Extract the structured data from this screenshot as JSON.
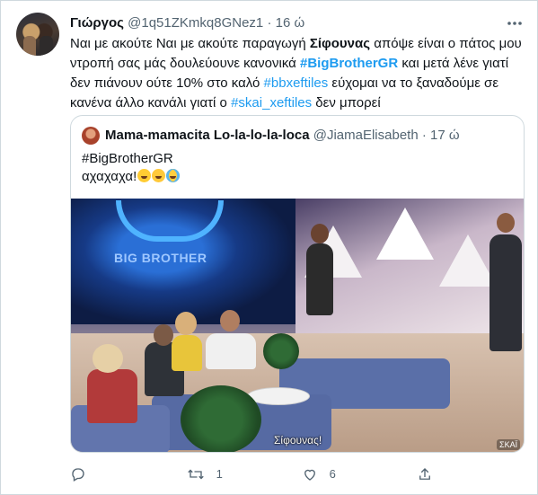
{
  "tweet": {
    "author_name": "Γιώργος",
    "author_handle": "@1q51ZKmkq8GNez1",
    "separator": "·",
    "time": "16 ώ",
    "text_parts": [
      {
        "t": "Ναι με ακούτε Ναι με ακούτε παραγωγή  ",
        "style": "plain"
      },
      {
        "t": "Σίφουνας",
        "style": "bold"
      },
      {
        "t": " απόψε είναι ο πάτος μου ντροπή  σας μάς δουλεύουνε  κανονικά ",
        "style": "plain"
      },
      {
        "t": "#BigBrotherGR",
        "style": "bold-link"
      },
      {
        "t": " και μετά λένε γιατί δεν πιάνουν ούτε 10% στο καλό ",
        "style": "plain"
      },
      {
        "t": "#bbxeftiles",
        "style": "link"
      },
      {
        "t": " εύχομαι να το ξαναδούμε σε κανένα άλλο κανάλι γιατί ο ",
        "style": "plain"
      },
      {
        "t": "#skai_xeftiles",
        "style": "link"
      },
      {
        "t": " δεν μπορεί",
        "style": "plain"
      }
    ],
    "more_icon": "more-dots-icon",
    "colors": {
      "link": "#1d9bf0",
      "muted": "#536471",
      "text": "#0f1419",
      "border": "#cfd9de"
    }
  },
  "quoted": {
    "author_name": "Mama-mamacita Lo-la-lo-la-loca",
    "author_handle": "@JiamaElisabeth",
    "separator": "·",
    "time": "17 ώ",
    "hashtag": "#BigBrotherGR",
    "text": "αχαχαχα!",
    "emojis": [
      "grinning-face-emoji",
      "winking-tongue-face-emoji",
      "tears-of-joy-emoji"
    ],
    "video": {
      "logo_text": "BIG BROTHER",
      "subtitle": "Σίφουνας!",
      "channel_badge": "ΣΚΑΪ"
    }
  },
  "actions": {
    "reply": {
      "icon": "reply-icon",
      "count": ""
    },
    "retweet": {
      "icon": "retweet-icon",
      "count": "1"
    },
    "like": {
      "icon": "heart-icon",
      "count": "6"
    },
    "share": {
      "icon": "share-icon",
      "count": ""
    }
  }
}
